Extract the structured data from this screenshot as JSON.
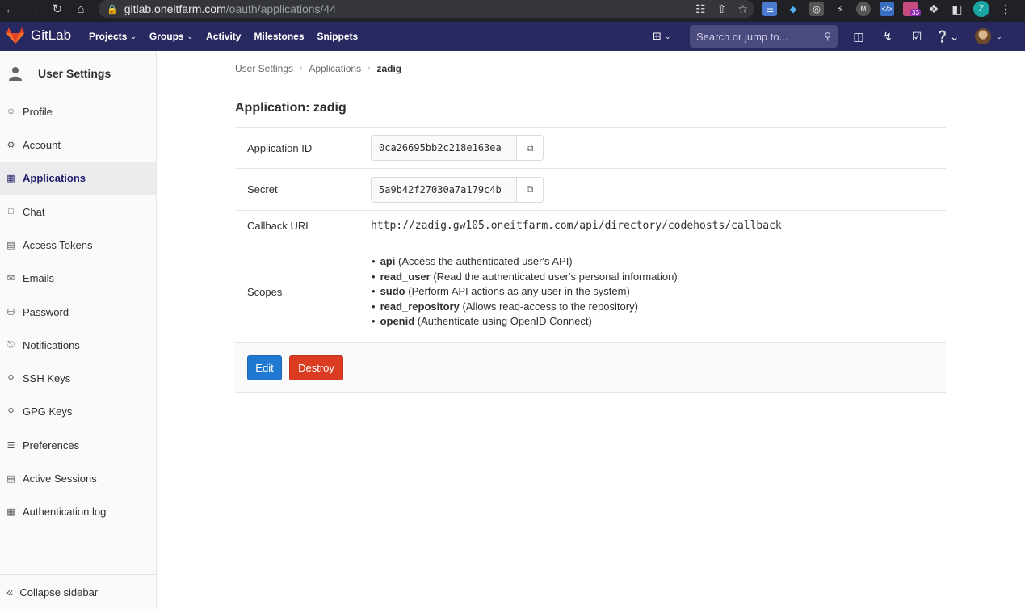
{
  "browser": {
    "url_host": "gitlab.oneitfarm.com",
    "url_path": "/oauth/applications/44",
    "ext_badge": "33",
    "profile_letter": "Z"
  },
  "header": {
    "logo_text": "GitLab",
    "menu": [
      {
        "label": "Projects"
      },
      {
        "label": "Groups"
      },
      {
        "label": "Activity"
      },
      {
        "label": "Milestones"
      },
      {
        "label": "Snippets"
      }
    ],
    "search_placeholder": "Search or jump to..."
  },
  "sidebar": {
    "title": "User Settings",
    "items": [
      {
        "label": "Profile",
        "icon": "profile-icon"
      },
      {
        "label": "Account",
        "icon": "account-icon"
      },
      {
        "label": "Applications",
        "icon": "applications-icon",
        "active": true
      },
      {
        "label": "Chat",
        "icon": "chat-icon"
      },
      {
        "label": "Access Tokens",
        "icon": "token-icon"
      },
      {
        "label": "Emails",
        "icon": "mail-icon"
      },
      {
        "label": "Password",
        "icon": "lock-icon"
      },
      {
        "label": "Notifications",
        "icon": "bell-icon"
      },
      {
        "label": "SSH Keys",
        "icon": "key-icon"
      },
      {
        "label": "GPG Keys",
        "icon": "key-icon"
      },
      {
        "label": "Preferences",
        "icon": "preferences-icon"
      },
      {
        "label": "Active Sessions",
        "icon": "monitor-icon"
      },
      {
        "label": "Authentication log",
        "icon": "log-icon"
      }
    ],
    "collapse_label": "Collapse sidebar"
  },
  "breadcrumb": {
    "items": [
      "User Settings",
      "Applications"
    ],
    "current": "zadig"
  },
  "page_title": "Application: zadig",
  "details": {
    "app_id_label": "Application ID",
    "app_id_value": "0ca26695bb2c218e163ea",
    "secret_label": "Secret",
    "secret_value": "5a9b42f27030a7a179c4b",
    "callback_label": "Callback URL",
    "callback_value": "http://zadig.gw105.oneitfarm.com/api/directory/codehosts/callback",
    "scopes_label": "Scopes",
    "scopes": [
      {
        "name": "api",
        "desc": "(Access the authenticated user's API)"
      },
      {
        "name": "read_user",
        "desc": "(Read the authenticated user's personal information)"
      },
      {
        "name": "sudo",
        "desc": "(Perform API actions as any user in the system)"
      },
      {
        "name": "read_repository",
        "desc": "(Allows read-access to the repository)"
      },
      {
        "name": "openid",
        "desc": "(Authenticate using OpenID Connect)"
      }
    ]
  },
  "actions": {
    "edit_label": "Edit",
    "destroy_label": "Destroy"
  },
  "colors": {
    "header_bg": "#292961",
    "active_nav": "#1f1f6b",
    "edit_btn": "#1f78d1",
    "destroy_btn": "#db3b21"
  }
}
